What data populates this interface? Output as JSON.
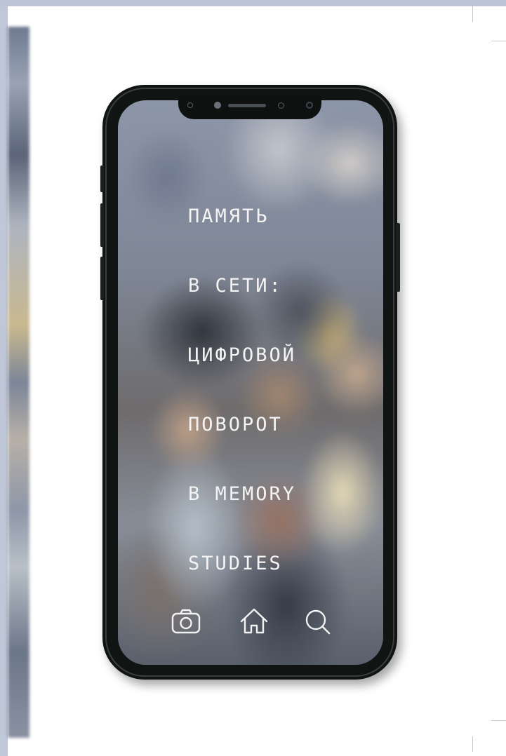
{
  "cover": {
    "title_lines": [
      "ПАМЯТЬ",
      "В СЕТИ:",
      "ЦИФРОВОЙ",
      "ПОВОРОТ",
      "В MEMORY",
      "STUDIES"
    ],
    "title_color": "#f4f4f4"
  },
  "phone": {
    "frame_color": "#101412",
    "bottom_icons": [
      "camera-icon",
      "home-icon",
      "search-icon"
    ]
  }
}
